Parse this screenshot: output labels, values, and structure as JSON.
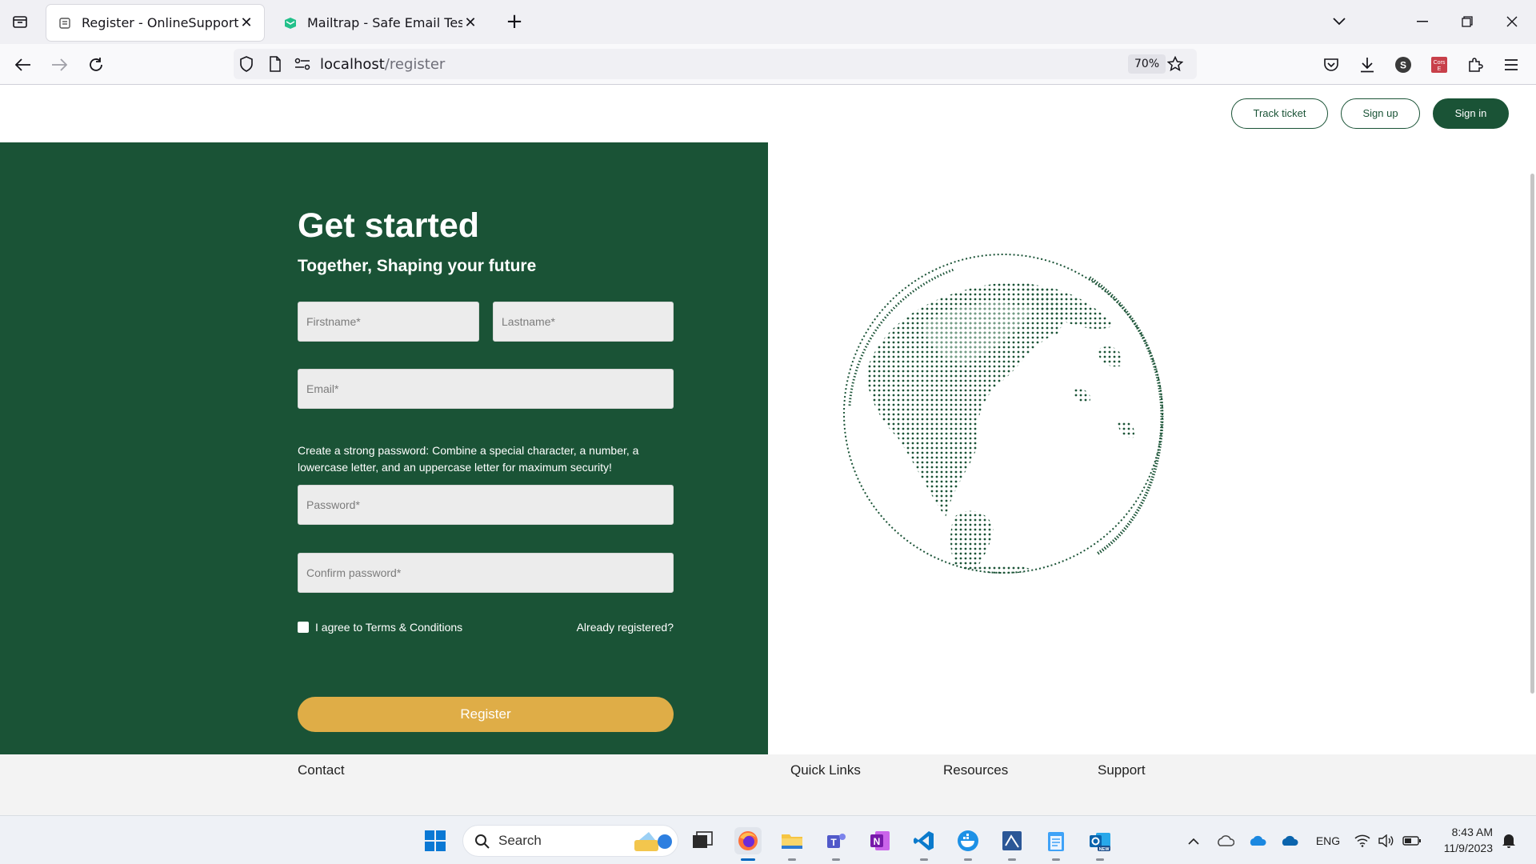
{
  "browser": {
    "tabs": [
      {
        "title": "Register - OnlineSupportSystem",
        "active": true
      },
      {
        "title": "Mailtrap - Safe Email Testing",
        "active": false
      }
    ],
    "url_host": "localhost",
    "url_path": "/register",
    "zoom": "70%",
    "profile_initial": "S",
    "ext_badge": "Cors E"
  },
  "header": {
    "track_ticket": "Track ticket",
    "sign_up": "Sign up",
    "sign_in": "Sign in"
  },
  "form": {
    "title": "Get started",
    "subtitle": "Together, Shaping your future",
    "firstname_placeholder": "Firstname*",
    "lastname_placeholder": "Lastname*",
    "email_placeholder": "Email*",
    "password_hint": "Create a strong password: Combine a special character, a number, a lowercase letter, and an uppercase letter for maximum security!",
    "password_placeholder": "Password*",
    "confirm_placeholder": "Confirm password*",
    "agree_label": "I agree to Terms & Conditions",
    "already_registered": "Already registered?",
    "register_button": "Register"
  },
  "footer": {
    "columns": [
      "Contact",
      "Quick Links",
      "Resources",
      "Support"
    ]
  },
  "taskbar": {
    "search_label": "Search",
    "language": "ENG",
    "time": "8:43 AM",
    "date": "11/9/2023"
  },
  "colors": {
    "brand_green": "#1a5336",
    "register_gold": "#dfad47"
  }
}
